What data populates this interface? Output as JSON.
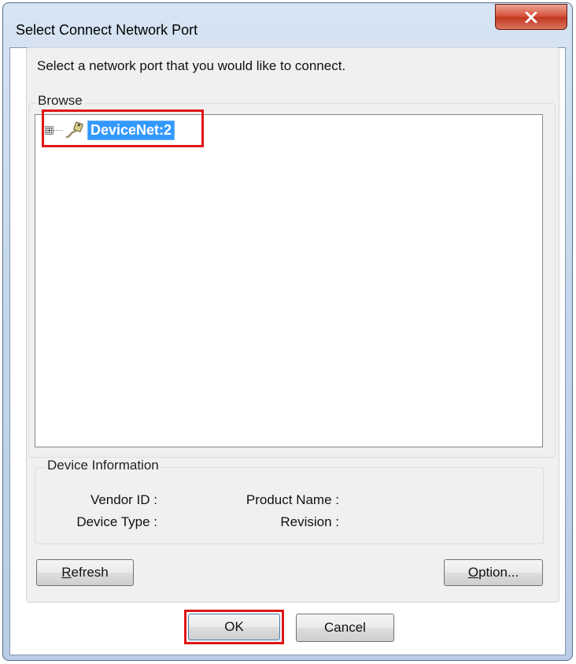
{
  "window": {
    "title": "Select Connect Network Port",
    "close_icon": "close-x-icon"
  },
  "instruction": "Select a network port that you would like to connect.",
  "browse": {
    "legend": "Browse",
    "tree": [
      {
        "label": "DeviceNet:2",
        "expander": "⊞",
        "icon": "network-port-icon",
        "selected": true
      }
    ]
  },
  "device_info": {
    "legend": "Device Information",
    "vendor_id_label": "Vendor ID :",
    "device_type_label": "Device Type :",
    "product_name_label": "Product Name :",
    "revision_label": "Revision :"
  },
  "buttons": {
    "refresh_prefix": "",
    "refresh_mnemonic": "R",
    "refresh_rest": "efresh",
    "option_mnemonic": "O",
    "option_rest": "ption...",
    "ok": "OK",
    "cancel": "Cancel"
  },
  "colors": {
    "selection": "#3399ff",
    "highlight_annotation": "#e01515",
    "close_button": "#c9452e"
  }
}
